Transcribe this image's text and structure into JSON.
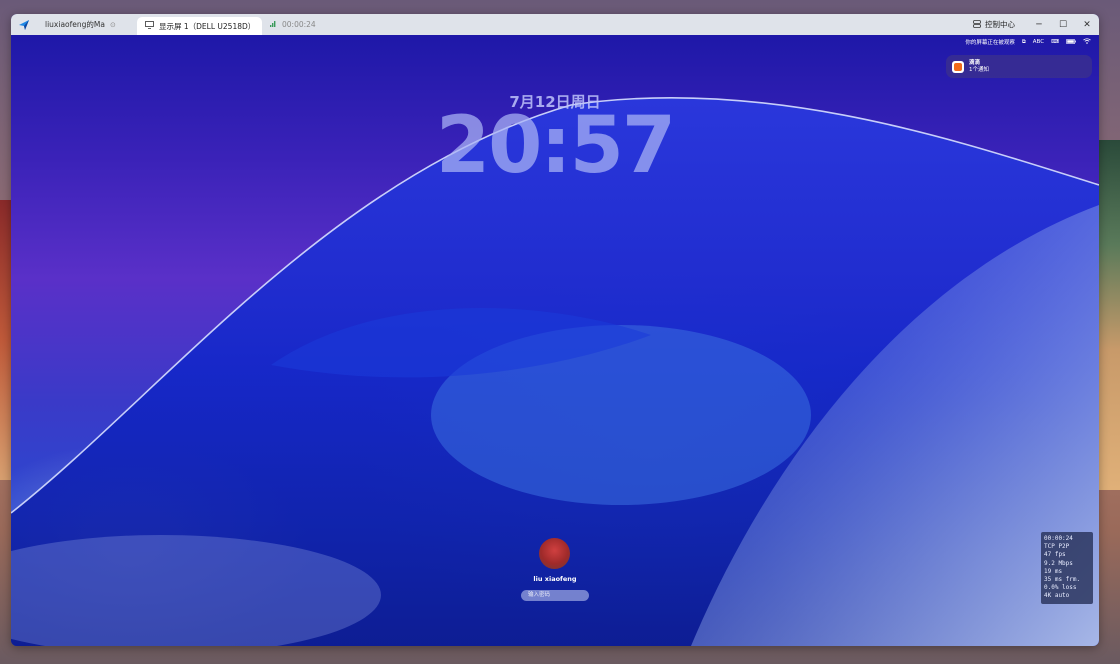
{
  "titlebar": {
    "session_label": "liuxiaofeng的Ma",
    "active_tab_label": "显示屏 1（DELL U2518D）",
    "timer": "00:00:24",
    "control_center_label": "控制中心",
    "minimize": "─",
    "maximize": "☐",
    "close": "✕"
  },
  "menubar": {
    "sharing_text": "你的屏幕正在被观察",
    "input_source": "ABC"
  },
  "notification": {
    "title": "滴滴",
    "subtitle": "1个通知"
  },
  "lockscreen": {
    "date": "7月12日周日",
    "time": "20:57",
    "username": "liu xiaofeng",
    "password_placeholder": "输入密码"
  },
  "stats": {
    "lines": [
      "00:00:24",
      "TCP P2P",
      "47 fps",
      "9.2 Mbps",
      "19 ms",
      "35 ms frm.",
      "0.0% loss",
      "4K auto"
    ]
  },
  "colors": {
    "wallpaper_primary": "#2a22b8",
    "titlebar_bg": "#dfe3ea",
    "notification_accent": "#f06a1a"
  }
}
